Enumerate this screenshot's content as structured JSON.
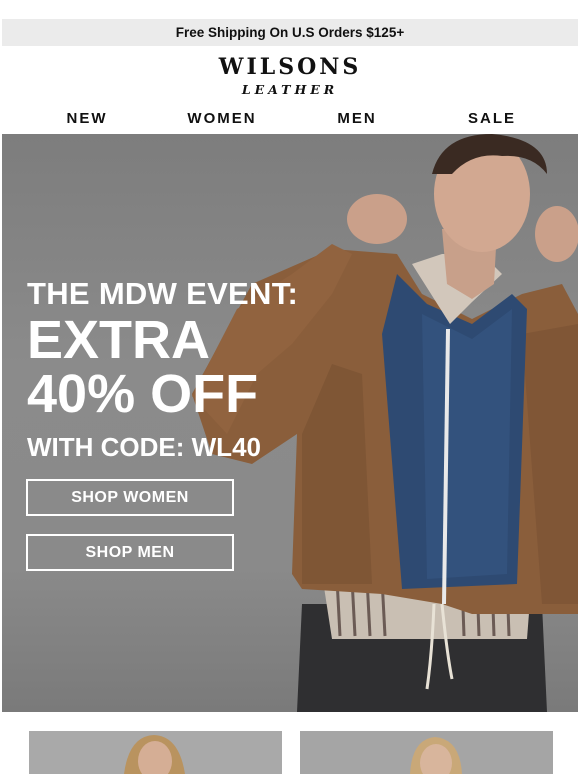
{
  "promo_bar": {
    "text": "Free Shipping On U.S Orders $125+"
  },
  "brand": {
    "logo_top": "WILSONS",
    "logo_bottom": "LEATHER"
  },
  "nav": {
    "items": [
      {
        "label": "NEW"
      },
      {
        "label": "WOMEN"
      },
      {
        "label": "MEN"
      },
      {
        "label": "SALE"
      }
    ]
  },
  "hero": {
    "line1": "THE MDW EVENT:",
    "line2": "EXTRA",
    "line3": "40% OFF",
    "line4": "WITH CODE: WL40",
    "cta_women": "SHOP WOMEN",
    "cta_men": "SHOP MEN",
    "image": "man-in-brown-suede-jacket-photo"
  },
  "tiles": [
    {
      "image": "woman-portrait-photo"
    },
    {
      "image": "woman-portrait-photo"
    }
  ],
  "colors": {
    "hero_bg": "#858585",
    "jacket": "#8a5e3b",
    "vest": "#2e4a72",
    "promo_bg": "#ebebeb"
  }
}
